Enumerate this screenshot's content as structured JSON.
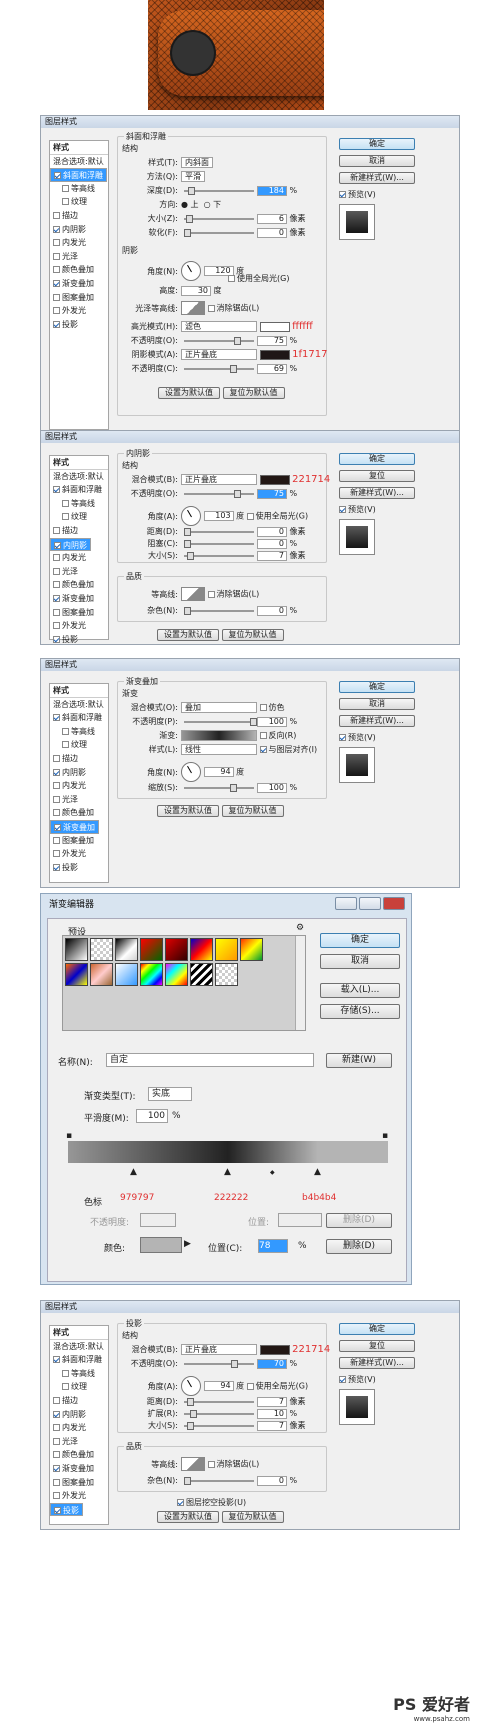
{
  "watermark": {
    "brand": "PS",
    "name": "爱好者",
    "url": "www.psahz.com"
  },
  "common": {
    "title": "图层样式",
    "ok": "确定",
    "cancel": "取消",
    "reset": "复位",
    "new_style": "新建样式(W)...",
    "preview": "预览(V)",
    "set_default": "设置为默认值",
    "reset_default": "复位为默认值"
  },
  "sidebar": [
    "样式",
    "混合选项:默认",
    "斜面和浮雕",
    "等高线",
    "纹理",
    "描边",
    "内阴影",
    "内发光",
    "光泽",
    "颜色叠加",
    "渐变叠加",
    "图案叠加",
    "外发光",
    "投影"
  ],
  "d1": {
    "section": "斜面和浮雕",
    "struct": "结构",
    "style_l": "样式(T):",
    "style_v": "内斜面",
    "tech_l": "方法(Q):",
    "tech_v": "平滑",
    "depth_l": "深度(D):",
    "depth_v": "184",
    "dir_l": "方向:",
    "up": "上",
    "down": "下",
    "size_l": "大小(Z):",
    "size_v": "6",
    "soft_l": "软化(F):",
    "soft_v": "0",
    "shading": "阴影",
    "angle_l": "角度(N):",
    "angle_v": "120",
    "deg": "度",
    "global": "使用全局光(G)",
    "alt_l": "高度:",
    "alt_v": "30",
    "gloss_l": "光泽等高线:",
    "aa": "消除锯齿(L)",
    "hl_l": "高光模式(H):",
    "hl_v": "滤色",
    "hl_color": "#ffffff",
    "hl_note": "ffffff",
    "op1_l": "不透明度(O):",
    "op1_v": "75",
    "sh_l": "阴影模式(A):",
    "sh_v": "正片叠底",
    "sh_color": "#1f1717",
    "sh_note": "1f1717",
    "op2_l": "不透明度(C):",
    "op2_v": "69",
    "px": "像素",
    "pct": "%"
  },
  "d2": {
    "section": "内阴影",
    "struct": "结构",
    "blend_l": "混合模式(B):",
    "blend_v": "正片叠底",
    "color": "#221714",
    "note": "221714",
    "op_l": "不透明度(O):",
    "op_v": "75",
    "angle_l": "角度(A):",
    "angle_v": "103",
    "dist_l": "距离(D):",
    "dist_v": "0",
    "choke_l": "阻塞(C):",
    "choke_v": "0",
    "size_l": "大小(S):",
    "size_v": "7",
    "quality": "品质",
    "contour_l": "等高线:",
    "noise_l": "杂色(N):",
    "noise_v": "0"
  },
  "d3": {
    "section": "渐变叠加",
    "grad": "渐变",
    "blend_l": "混合模式(O):",
    "blend_v": "叠加",
    "dither": "仿色",
    "op_l": "不透明度(P):",
    "op_v": "100",
    "grad_l": "渐变:",
    "reverse": "反向(R)",
    "style_l": "样式(L):",
    "style_v": "线性",
    "align": "与图层对齐(I)",
    "angle_l": "角度(N):",
    "angle_v": "94",
    "scale_l": "缩放(S):",
    "scale_v": "100"
  },
  "ge": {
    "title": "渐变编辑器",
    "presets": "预设",
    "ok": "确定",
    "cancel": "取消",
    "load": "载入(L)...",
    "save": "存储(S)...",
    "name_l": "名称(N):",
    "name_v": "自定",
    "new": "新建(W)",
    "type_l": "渐变类型(T):",
    "type_v": "实底",
    "smooth_l": "平滑度(M):",
    "smooth_v": "100",
    "stops": "色标",
    "c1": "979797",
    "c2": "222222",
    "c3": "b4b4b4",
    "opacity_l": "不透明度:",
    "loc_l": "位置:",
    "del": "删除(D)",
    "color_l": "颜色:",
    "loc2_l": "位置(C):",
    "loc2_v": "78"
  },
  "d4": {
    "section": "投影",
    "struct": "结构",
    "blend_l": "混合模式(B):",
    "blend_v": "正片叠底",
    "color": "#221714",
    "note": "221714",
    "op_l": "不透明度(O):",
    "op_v": "70",
    "angle_l": "角度(A):",
    "angle_v": "94",
    "dist_l": "距离(D):",
    "dist_v": "7",
    "spread_l": "扩展(R):",
    "spread_v": "10",
    "size_l": "大小(S):",
    "size_v": "7",
    "quality": "品质",
    "contour_l": "等高线:",
    "noise_l": "杂色(N):",
    "noise_v": "0",
    "knock": "图层挖空投影(U)"
  }
}
